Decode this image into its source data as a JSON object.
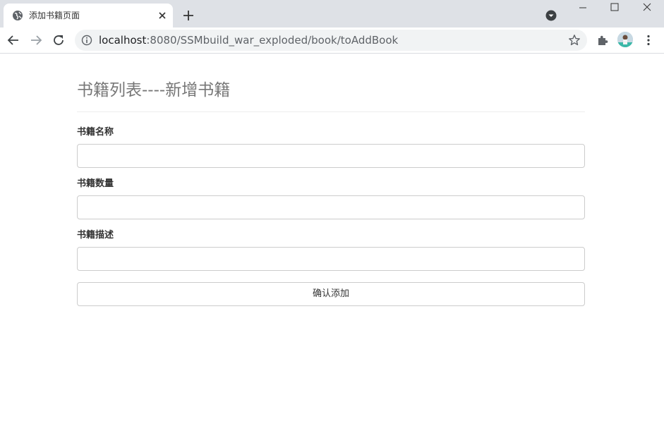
{
  "tab": {
    "title": "添加书籍页面"
  },
  "address_bar": {
    "host": "localhost",
    "path": ":8080/SSMbuild_war_exploded/book/toAddBook"
  },
  "page": {
    "title": "书籍列表----新增书籍",
    "fields": [
      {
        "label": "书籍名称",
        "value": ""
      },
      {
        "label": "书籍数量",
        "value": ""
      },
      {
        "label": "书籍描述",
        "value": ""
      }
    ],
    "submit_label": "确认添加"
  }
}
